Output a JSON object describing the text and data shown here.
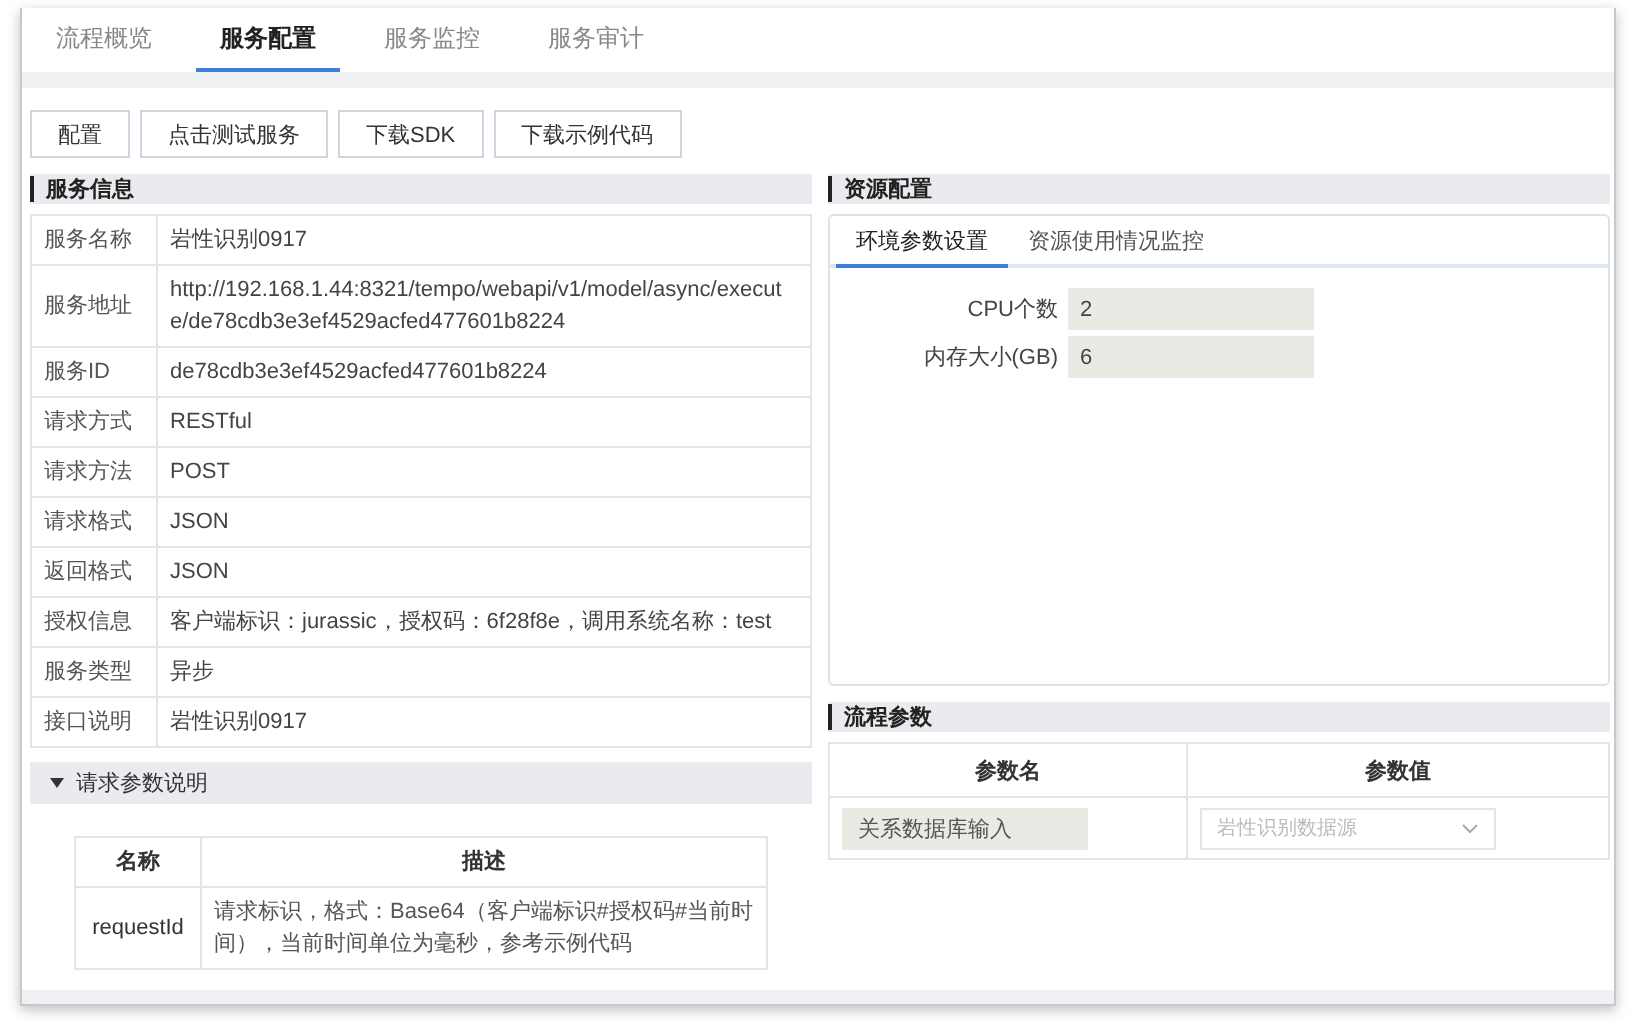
{
  "tabs": [
    {
      "label": "流程概览",
      "selected": false
    },
    {
      "label": "服务配置",
      "selected": true
    },
    {
      "label": "服务监控",
      "selected": false
    },
    {
      "label": "服务审计",
      "selected": false
    }
  ],
  "toolbar": [
    "配置",
    "点击测试服务",
    "下载SDK",
    "下载示例代码"
  ],
  "service_info": {
    "title": "服务信息",
    "rows": [
      {
        "label": "服务名称",
        "value": "岩性识别0917"
      },
      {
        "label": "服务地址",
        "value": "http://192.168.1.44:8321/tempo/webapi/v1/model/async/execute/de78cdb3e3ef4529acfed477601b8224"
      },
      {
        "label": "服务ID",
        "value": "de78cdb3e3ef4529acfed477601b8224"
      },
      {
        "label": "请求方式",
        "value": "RESTful"
      },
      {
        "label": "请求方法",
        "value": "POST"
      },
      {
        "label": "请求格式",
        "value": "JSON"
      },
      {
        "label": "返回格式",
        "value": "JSON"
      },
      {
        "label": "授权信息",
        "value": "客户端标识：jurassic，授权码：6f28f8e，调用系统名称：test"
      },
      {
        "label": "服务类型",
        "value": "异步"
      },
      {
        "label": "接口说明",
        "value": "岩性识别0917"
      }
    ]
  },
  "request_params": {
    "title": "请求参数说明",
    "expanded": true,
    "columns": [
      "名称",
      "描述"
    ],
    "rows": [
      {
        "name": "requestId",
        "description": "请求标识，格式：Base64（客户端标识#授权码#当前时间），当前时间单位为毫秒，参考示例代码"
      }
    ]
  },
  "resource_config": {
    "title": "资源配置",
    "tabs": [
      {
        "label": "环境参数设置",
        "selected": true
      },
      {
        "label": "资源使用情况监控",
        "selected": false
      }
    ],
    "fields": [
      {
        "label": "CPU个数",
        "value": "2"
      },
      {
        "label": "内存大小(GB)",
        "value": "6"
      }
    ]
  },
  "flow_params": {
    "title": "流程参数",
    "columns": [
      "参数名",
      "参数值"
    ],
    "rows": [
      {
        "name": "关系数据库输入",
        "value": "岩性识别数据源"
      }
    ]
  }
}
